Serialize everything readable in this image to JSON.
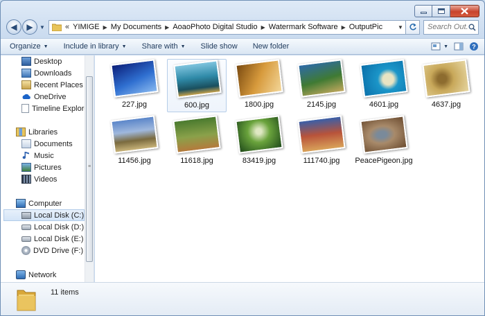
{
  "window": {
    "buttons": {
      "minimize_icon": "minimize-icon",
      "maximize_icon": "maximize-icon",
      "close_icon": "close-icon"
    }
  },
  "address": {
    "overflow_glyph": "«",
    "crumbs": [
      "YIMIGE",
      "My Documents",
      "AoaoPhoto Digital Studio",
      "Watermark Software",
      "OutputPic"
    ]
  },
  "search": {
    "placeholder": "Search Out..."
  },
  "toolbar": {
    "organize": "Organize",
    "include_in_library": "Include in library",
    "share_with": "Share with",
    "slide_show": "Slide show",
    "new_folder": "New folder"
  },
  "nav": {
    "favorites": [
      "Desktop",
      "Downloads",
      "Recent Places",
      "OneDrive",
      "Timeline Explorer"
    ],
    "libraries_label": "Libraries",
    "libraries": [
      "Documents",
      "Music",
      "Pictures",
      "Videos"
    ],
    "computer_label": "Computer",
    "drives": [
      "Local Disk (C:)",
      "Local Disk (D:)",
      "Local Disk (E:)",
      "DVD Drive (F:) PE"
    ],
    "network_label": "Network"
  },
  "files": [
    {
      "name": "227.jpg",
      "colors": [
        "#0b1f7a",
        "#2f6fd0",
        "#89b9ef"
      ]
    },
    {
      "name": "600.jpg",
      "colors": [
        "#2f8aa8",
        "#1a4f5e",
        "#c9a24a"
      ]
    },
    {
      "name": "1800.jpg",
      "colors": [
        "#7a4a10",
        "#d79a3c",
        "#f3d79a"
      ]
    },
    {
      "name": "2145.jpg",
      "colors": [
        "#2d6aa8",
        "#3f7a33",
        "#c2a85e"
      ]
    },
    {
      "name": "4601.jpg",
      "colors": [
        "#0a6ea8",
        "#1b96c9",
        "#e9e4c3"
      ]
    },
    {
      "name": "4637.jpg",
      "colors": [
        "#c8a85a",
        "#8d6c2f",
        "#e6d6a2"
      ]
    },
    {
      "name": "11456.jpg",
      "colors": [
        "#5b86c9",
        "#7a6a3e",
        "#c9b47a"
      ]
    },
    {
      "name": "11618.jpg",
      "colors": [
        "#4a7a2e",
        "#8aa14a",
        "#b57a3c"
      ]
    },
    {
      "name": "83419.jpg",
      "colors": [
        "#1f4a1a",
        "#6aa33c",
        "#dfe8c3"
      ]
    },
    {
      "name": "111740.jpg",
      "colors": [
        "#3a5fa8",
        "#b8533a",
        "#d9a35a"
      ]
    },
    {
      "name": "PeacePigeon.jpg",
      "colors": [
        "#6a4a2e",
        "#a88a6a",
        "#7a8a9a"
      ]
    }
  ],
  "status": {
    "items_count": "11 items"
  }
}
